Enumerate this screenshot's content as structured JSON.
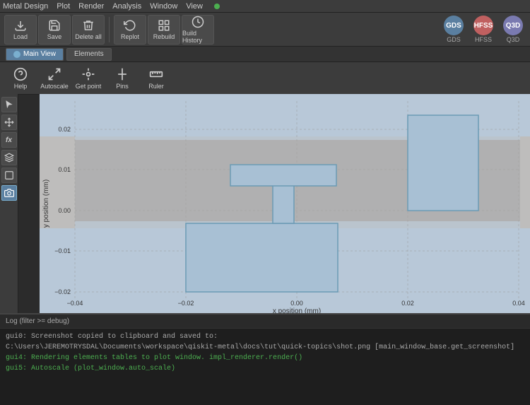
{
  "menubar": {
    "items": [
      "Metal Design",
      "Plot",
      "Render",
      "Analysis",
      "Window",
      "View"
    ],
    "active_dot": true
  },
  "toolbar": {
    "buttons": [
      {
        "label": "Load",
        "icon": "load"
      },
      {
        "label": "Save",
        "icon": "save"
      },
      {
        "label": "Delete all",
        "icon": "delete"
      },
      {
        "label": "Replot",
        "icon": "replot"
      },
      {
        "label": "Rebuild",
        "icon": "rebuild"
      },
      {
        "label": "Build History",
        "icon": "history"
      }
    ]
  },
  "eda_tools": {
    "buttons": [
      {
        "label": "GDS",
        "sublabel": "GDS",
        "class": "gds",
        "text": "GDS"
      },
      {
        "label": "HFSS",
        "sublabel": "HFSS",
        "class": "hfss",
        "text": "HFSS"
      },
      {
        "label": "Q3D",
        "sublabel": "Q3D",
        "class": "q3d",
        "text": "Q3D"
      }
    ]
  },
  "tabs": {
    "items": [
      {
        "label": "Main View",
        "active": true
      },
      {
        "label": "Elements",
        "active": false
      }
    ]
  },
  "toolbar2": {
    "buttons": [
      {
        "label": "Help",
        "icon": "help"
      },
      {
        "label": "Autoscale",
        "icon": "autoscale"
      },
      {
        "label": "Get point",
        "icon": "getpoint"
      },
      {
        "label": "Pins",
        "icon": "pins"
      },
      {
        "label": "Ruler",
        "icon": "ruler"
      }
    ]
  },
  "sidebar": {
    "buttons": [
      {
        "icon": "cursor",
        "active": false
      },
      {
        "icon": "move",
        "active": false
      },
      {
        "icon": "fx",
        "active": false
      },
      {
        "icon": "layers",
        "active": false
      },
      {
        "icon": "shape",
        "active": false
      },
      {
        "icon": "camera",
        "active": true
      }
    ]
  },
  "plot": {
    "x_label": "x position (mm)",
    "y_label": "y position (mm)",
    "x_ticks": [
      "-0.04",
      "-0.02",
      "0.00",
      "0.02",
      "0.04"
    ],
    "y_ticks": [
      "0.02",
      "0.01",
      "0.00",
      "-0.01",
      "-0.02"
    ]
  },
  "log": {
    "header": "Log (filter >= debug)",
    "lines": [
      {
        "text": "gui0: Screenshot copied to clipboard and saved to:",
        "class": ""
      },
      {
        "text": "C:\\Users\\JEREMOTRYSDAL\\Documents\\workspace\\qiskit-metal\\docs\\tut\\quick-topics\\shot.png [main_window_base.get_screenshot]",
        "class": "path"
      },
      {
        "text": "gui4: Rendering elements tables to plot window. impl_renderer.render()",
        "class": "green"
      },
      {
        "text": "gui5: Autoscale (plot_window.auto_scale)",
        "class": "green"
      }
    ]
  }
}
